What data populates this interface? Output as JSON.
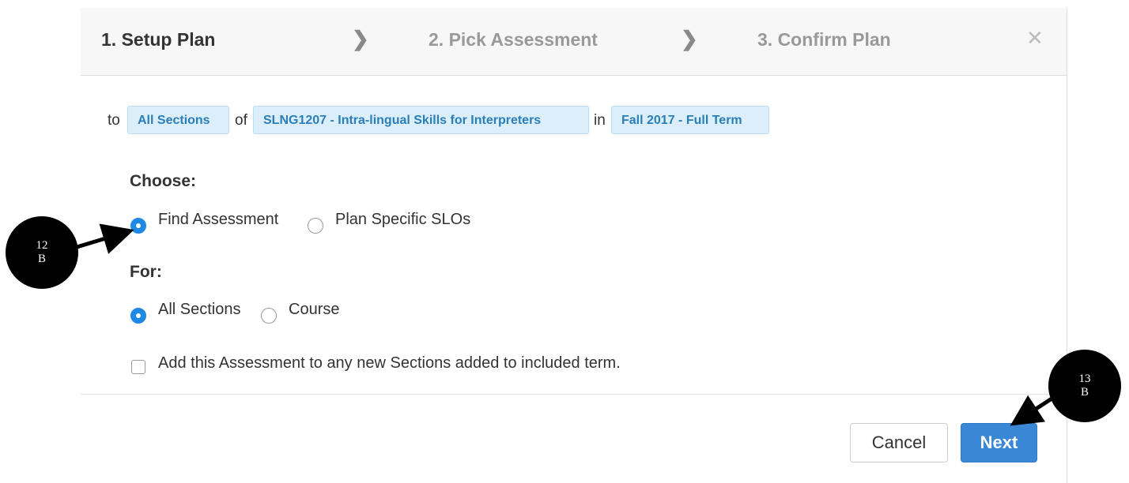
{
  "wizard": {
    "steps": [
      {
        "label": "1. Setup Plan",
        "state": "active"
      },
      {
        "label": "2. Pick Assessment",
        "state": "inactive"
      },
      {
        "label": "3. Confirm Plan",
        "state": "inactive"
      }
    ],
    "separator_icon": "chevron-right-icon",
    "close_icon": "close-icon",
    "close_glyph": "✕"
  },
  "context": {
    "word_to": "to",
    "sections_pill": "All Sections",
    "word_of": "of",
    "course_pill": "SLNG1207 - Intra-lingual Skills for Interpreters",
    "word_in": "in",
    "term_pill": "Fall 2017 - Full Term"
  },
  "choose": {
    "label": "Choose:",
    "options": [
      {
        "label": "Find Assessment",
        "selected": true
      },
      {
        "label": "Plan Specific SLOs",
        "selected": false
      }
    ]
  },
  "for": {
    "label": "For:",
    "options": [
      {
        "label": "All Sections",
        "selected": true
      },
      {
        "label": "Course",
        "selected": false
      }
    ]
  },
  "auto_add": {
    "label": "Add this Assessment to any new Sections added to included term.",
    "checked": false
  },
  "footer": {
    "cancel_label": "Cancel",
    "next_label": "Next"
  },
  "annotations": [
    {
      "line1": "12",
      "line2": "B"
    },
    {
      "line1": "13",
      "line2": "B"
    }
  ],
  "colors": {
    "accent": "#3a87d5",
    "radio_selected": "#1e88e5",
    "pill_bg": "#dceefa",
    "pill_text": "#2a7fb8",
    "header_bg": "#f7f7f7"
  }
}
